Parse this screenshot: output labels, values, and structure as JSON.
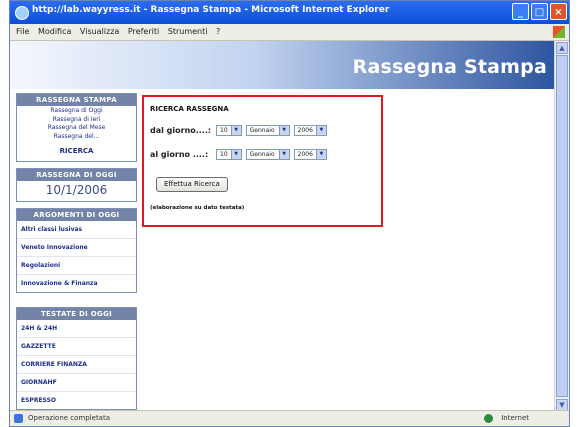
{
  "window": {
    "title": "http://lab.wayyress.it - Rassegna Stampa - Microsoft Internet Explorer",
    "controls": [
      "_",
      "□",
      "×"
    ]
  },
  "menu": [
    "File",
    "Modifica",
    "Visualizza",
    "Preferiti",
    "Strumenti",
    "?"
  ],
  "header": {
    "title": "Rassegna Stampa"
  },
  "sidebar": {
    "rassegna_stampa": {
      "heading": "RASSEGNA STAMPA",
      "links": [
        "Rassegna di Oggi",
        "Rassegna di Ieri",
        "Rassegna del Mese",
        "Rassegna del..."
      ],
      "search_link": "RICERCA"
    },
    "rassegna_oggi": {
      "heading": "RASSEGNA DI OGGI",
      "date": "10/1/2006"
    },
    "argomenti": {
      "heading": "ARGOMENTI DI OGGI",
      "items": [
        "Altri classi lusivas",
        "Veneto Innovazione",
        "Regolazioni",
        "Innovazione & Finanza"
      ]
    },
    "testate": {
      "heading": "TESTATE DI OGGI",
      "items": [
        "24H & 24H",
        "GAZZETTE",
        "CORRIERE FINANZA",
        "GIORNAHF",
        "ESPRESSO"
      ]
    }
  },
  "search": {
    "title": "RICERCA RASSEGNA",
    "from": {
      "label": "dal giorno....:",
      "day": "10",
      "month": "Gennaio",
      "year": "2006"
    },
    "to": {
      "label": "al giorno ....:",
      "day": "10",
      "month": "Gennaio",
      "year": "2006"
    },
    "button": "Effettua Ricerca",
    "note": "(elaborazione su dato testata)"
  },
  "status": {
    "left": "Operazione completata",
    "right": "Internet"
  },
  "colors": {
    "highlight_border": "#e3171d",
    "header_dark": "#2d55a0",
    "sidebar_heading": "#7484a8"
  }
}
